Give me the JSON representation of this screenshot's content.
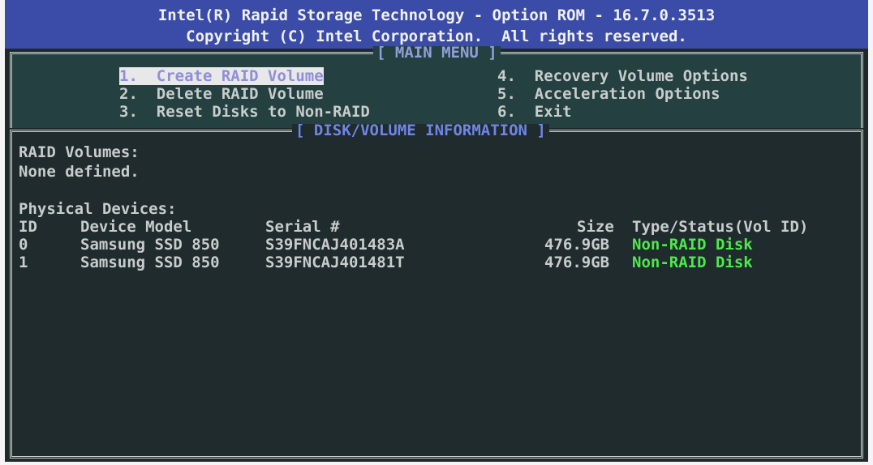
{
  "header": {
    "line1": "Intel(R) Rapid Storage Technology - Option ROM - 16.7.0.3513",
    "line2": "Copyright (C) Intel Corporation.  All rights reserved."
  },
  "main_menu": {
    "title": "[ MAIN MENU ]",
    "items": [
      {
        "label": "1.  Create RAID Volume"
      },
      {
        "label": "2.  Delete RAID Volume"
      },
      {
        "label": "3.  Reset Disks to Non-RAID"
      },
      {
        "label": "4.  Recovery Volume Options"
      },
      {
        "label": "5.  Acceleration Options"
      },
      {
        "label": "6.  Exit"
      }
    ]
  },
  "disk_info": {
    "title": "[ DISK/VOLUME INFORMATION ]",
    "raid_volumes_heading": "RAID Volumes:",
    "raid_volumes_value": "None defined.",
    "physical_devices_heading": "Physical Devices:",
    "columns": {
      "id": "ID",
      "model": "Device Model",
      "serial": "Serial #",
      "size": "Size",
      "type": "Type/Status(Vol ID)"
    },
    "devices": [
      {
        "id": "0",
        "model": "Samsung SSD 850",
        "serial": "S39FNCAJ401483A",
        "size": "476.9GB",
        "type": "Non-RAID Disk"
      },
      {
        "id": "1",
        "model": "Samsung SSD 850",
        "serial": "S39FNCAJ401481T",
        "size": "476.9GB",
        "type": "Non-RAID Disk"
      }
    ]
  },
  "colors": {
    "header_bg": "#3a4ca8",
    "screen_bg": "#1e2a2a",
    "status_green": "#4ee84e"
  }
}
